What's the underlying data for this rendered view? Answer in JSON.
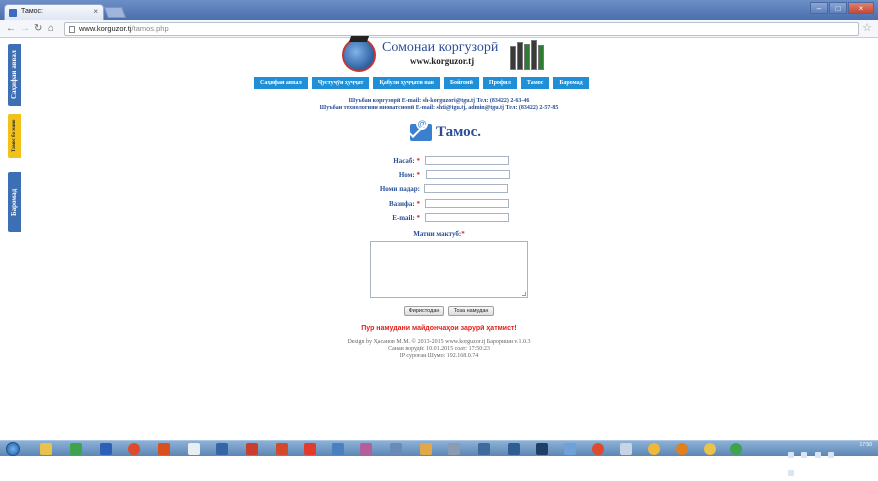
{
  "browser": {
    "tab_title": "Тамос:",
    "tab_close": "×",
    "url_host": "www.korguzor.tj",
    "url_path": "/tamos.php"
  },
  "sidebar": {
    "items": [
      {
        "label": "Саҳифаи аввал"
      },
      {
        "label": "Тамос бо мано"
      },
      {
        "label": "Баромад"
      }
    ]
  },
  "header": {
    "logo_title": "Сомонаи коргузорӣ",
    "logo_url": "www.korguzor.tj"
  },
  "menu": {
    "items": [
      {
        "label": "Саҳифаи аввал"
      },
      {
        "label": "Ҷустуҷӯи ҳуҷҷат"
      },
      {
        "label": "Қабули ҳуҷҷати нав"
      },
      {
        "label": "Бойгонӣ"
      },
      {
        "label": "Профил"
      },
      {
        "label": "Тамос"
      },
      {
        "label": "Баромад"
      }
    ]
  },
  "contact": {
    "line1": "Шуъбаи коргузорӣ E-mail: sh-korguzori@tgu.tj Тел: (83422) 2-63-46",
    "line2": "Шуъбаи технологияи иноватсионӣ E-mail: shti@tgu.tj, admin@tgu.tj Тел: (83422) 2-57-85"
  },
  "form": {
    "heading": "Тамос.",
    "fields": [
      {
        "label": "Насаб:",
        "required": true
      },
      {
        "label": "Ном:",
        "required": true
      },
      {
        "label": "Номи падар:",
        "required": false
      },
      {
        "label": "Вазифа:",
        "required": true
      },
      {
        "label": "E-mail:",
        "required": true
      }
    ],
    "required_mark": "*",
    "message_label": "Матни мактуб:",
    "submit_label": "Фиристодан",
    "reset_label": "Тоза намудан",
    "warning": "Пур намудани майдончаҳои зарурӣ ҳатмист!"
  },
  "footer": {
    "line1": "Design by Ҳасанов М.М. © 2013-2015 www.korguzor.tj Барориши v.1.0.3",
    "line2": "Санаи ворудӣ: 10.01.2015 соат: 17:50:23",
    "line3": "IP суроғаи Шумо: 192.168.0.74"
  },
  "taskbar": {
    "time": "17:50"
  }
}
